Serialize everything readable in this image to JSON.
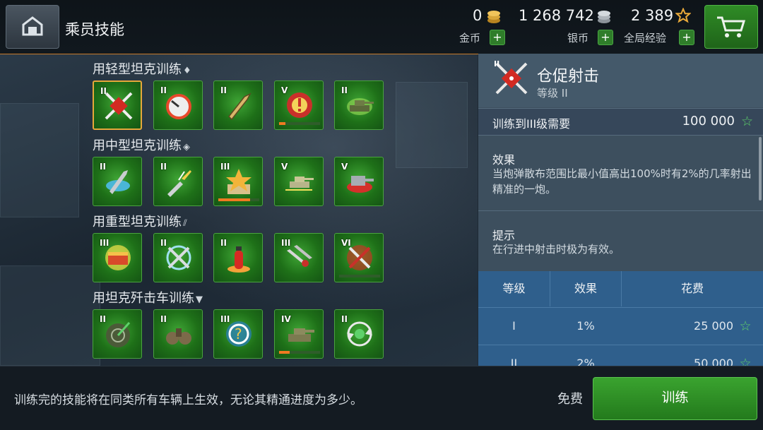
{
  "header": {
    "title": "乘员技能",
    "gold": {
      "value": "0",
      "label": "金币"
    },
    "silver": {
      "value": "1 268 742",
      "label": "银币"
    },
    "xp": {
      "value": "2 389",
      "label": "全局经验"
    }
  },
  "groups": [
    {
      "label": "用轻型坦克训练",
      "mark": "♦",
      "skills": [
        {
          "level": "II",
          "icon": "crosshair-cube-icon",
          "selected": true
        },
        {
          "level": "II",
          "icon": "gauge-icon"
        },
        {
          "level": "II",
          "icon": "shell-icon"
        },
        {
          "level": "V",
          "icon": "target-alert-icon",
          "progress": 0.15
        },
        {
          "level": "II",
          "icon": "tank-glow-icon"
        }
      ]
    },
    {
      "label": "用中型坦克训练",
      "mark": "◈",
      "skills": [
        {
          "level": "II",
          "icon": "spin-shell-icon"
        },
        {
          "level": "II",
          "icon": "breaking-shell-icon"
        },
        {
          "level": "III",
          "icon": "star-map-icon",
          "progress": 0.78
        },
        {
          "level": "V",
          "icon": "tank-move-icon"
        },
        {
          "level": "V",
          "icon": "turret-icon"
        }
      ]
    },
    {
      "label": "用重型坦克训练",
      "mark": "⫽",
      "skills": [
        {
          "level": "III",
          "icon": "armor-burst-icon"
        },
        {
          "level": "II",
          "icon": "crossed-tools-icon"
        },
        {
          "level": "II",
          "icon": "extinguisher-icon"
        },
        {
          "level": "III",
          "icon": "double-shell-icon"
        },
        {
          "level": "VI",
          "icon": "repair-tools-icon",
          "progress": 0.0
        }
      ]
    },
    {
      "label": "用坦克歼击车训练",
      "mark": "▼",
      "skills": [
        {
          "level": "II",
          "icon": "camo-target-icon"
        },
        {
          "level": "II",
          "icon": "binoculars-icon"
        },
        {
          "level": "III",
          "icon": "question-light-icon"
        },
        {
          "level": "IV",
          "icon": "tank-camo-icon",
          "progress": 0.25
        },
        {
          "level": "II",
          "icon": "reload-cycle-icon"
        }
      ]
    }
  ],
  "detail": {
    "name": "仓促射击",
    "level": "等级 II",
    "train_req": "训练到III级需要",
    "train_cost": "100 000",
    "effect_title": "效果",
    "effect_text": "当炮弹散布范围比最小值高出100%时有2%的几率射出精准的一炮。",
    "hint_title": "提示",
    "hint_text": "在行进中射击时极为有效。",
    "table_headers": [
      "等级",
      "效果",
      "花费"
    ],
    "table_rows": [
      {
        "level": "I",
        "effect": "1%",
        "cost": "25 000"
      },
      {
        "level": "II",
        "effect": "2%",
        "cost": "50 000"
      }
    ]
  },
  "footer": {
    "hint": "训练完的技能将在同类所有车辆上生效，无论其精通进度为多少。",
    "free": "免费",
    "train_button": "训练"
  },
  "colors": {
    "accent_orange": "#e7a83a",
    "green": "#2f8b26",
    "star_green": "#5ed16a",
    "progress": "#ef7a22"
  }
}
